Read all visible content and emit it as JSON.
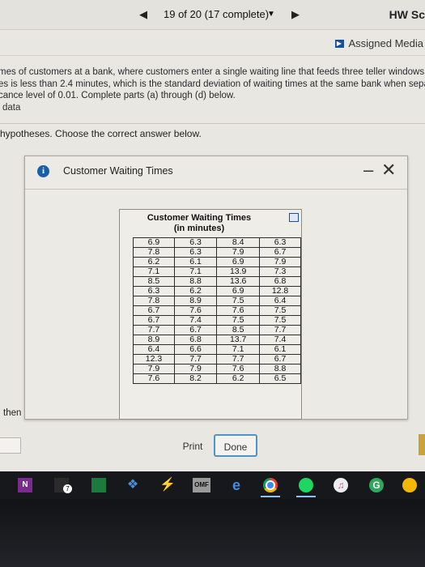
{
  "topbar": {
    "prev_icon": "◀",
    "status": "19 of 20 (17 complete)",
    "dropdown_icon": "▼",
    "next_icon": "▶",
    "hw_title": "HW Sc"
  },
  "media": {
    "label": "Assigned Media",
    "icon": "▶"
  },
  "problem": {
    "line1": "mes of customers at a bank, where customers enter a single waiting line that feeds three teller windows",
    "line2": "es is less than 2.4 minutes, which is the standard deviation of waiting times at the same bank when sepa",
    "line3": "cance level of 0.01. Complete parts (a) through (d) below.",
    "data_link": "data"
  },
  "question": "hypotheses. Choose the correct answer below.",
  "then_label": "then",
  "modal": {
    "title": "Customer Waiting Times",
    "info_icon": "i",
    "minimize_icon": "–",
    "close_icon": "✕",
    "table_title_line1": "Customer Waiting Times",
    "table_title_line2": "(in minutes)",
    "rows": [
      [
        "6.9",
        "6.3",
        "8.4",
        "6.3"
      ],
      [
        "7.8",
        "6.3",
        "7.9",
        "6.7"
      ],
      [
        "6.2",
        "6.1",
        "6.9",
        "7.9"
      ],
      [
        "7.1",
        "7.1",
        "13.9",
        "7.3"
      ],
      [
        "8.5",
        "8.8",
        "13.6",
        "6.8"
      ],
      [
        "6.3",
        "6.2",
        "6.9",
        "12.8"
      ],
      [
        "7.8",
        "8.9",
        "7.5",
        "6.4"
      ],
      [
        "6.7",
        "7.6",
        "7.6",
        "7.5"
      ],
      [
        "6.7",
        "7.4",
        "7.5",
        "7.5"
      ],
      [
        "7.7",
        "6.7",
        "8.5",
        "7.7"
      ],
      [
        "8.9",
        "6.8",
        "13.7",
        "7.4"
      ],
      [
        "6.4",
        "6.6",
        "7.1",
        "6.1"
      ],
      [
        "12.3",
        "7.7",
        "7.7",
        "6.7"
      ],
      [
        "7.9",
        "7.9",
        "7.6",
        "8.8"
      ],
      [
        "7.6",
        "8.2",
        "6.2",
        "6.5"
      ]
    ],
    "print_label": "Print",
    "done_label": "Done"
  },
  "taskbar": {
    "onenote": "N",
    "mail_badge": "7",
    "dropbox": "❖",
    "messenger": "⚡",
    "omf": "OMF",
    "edge": "e",
    "itunes": "♫",
    "g": "G"
  }
}
